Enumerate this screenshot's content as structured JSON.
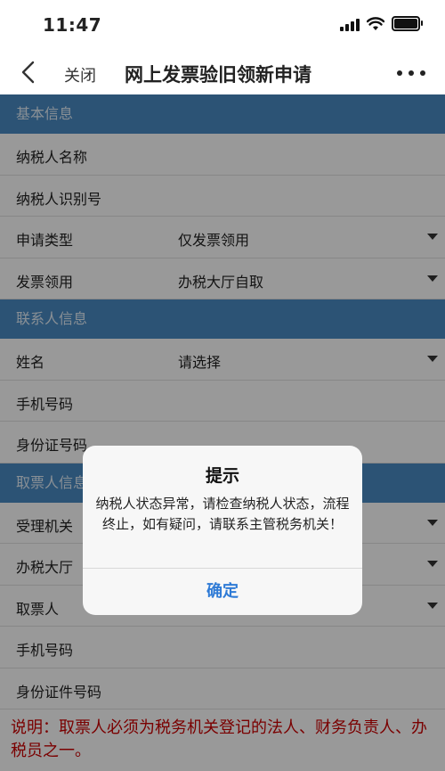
{
  "status_bar": {
    "time": "11:47"
  },
  "nav": {
    "close_label": "关闭",
    "title": "网上发票验旧领新申请"
  },
  "sections": {
    "basic": {
      "header": "基本信息",
      "rows": [
        {
          "label": "纳税人名称",
          "value": ""
        },
        {
          "label": "纳税人识别号",
          "value": ""
        },
        {
          "label": "申请类型",
          "value": "仅发票领用"
        },
        {
          "label": "发票领用",
          "value": "办税大厅自取"
        }
      ]
    },
    "contact": {
      "header": "联系人信息",
      "rows": [
        {
          "label": "姓名",
          "value": "请选择"
        },
        {
          "label": "手机号码",
          "value": ""
        },
        {
          "label": "身份证号码",
          "value": ""
        }
      ]
    },
    "pickup": {
      "header": "取票人信息",
      "rows": [
        {
          "label": "受理机关",
          "value": ""
        },
        {
          "label": "办税大厅",
          "value": ""
        },
        {
          "label": "取票人",
          "value": ""
        },
        {
          "label": "手机号码",
          "value": ""
        },
        {
          "label": "身份证件号码",
          "value": ""
        }
      ]
    }
  },
  "note": "说明：取票人必须为税务机关登记的法人、财务负责人、办税员之一。",
  "dialog": {
    "title": "提示",
    "message": "纳税人状态异常，请检查纳税人状态，流程终止，如有疑问，请联系主管税务机关！",
    "confirm_label": "确定"
  },
  "colors": {
    "section_header": "#4a8ac4",
    "note_text": "#cc0000",
    "dialog_button": "#2f7bd6"
  },
  "icons": [
    "back-chevron-icon",
    "more-dots-icon",
    "signal-icon",
    "wifi-icon",
    "battery-icon",
    "dropdown-caret-icon"
  ]
}
